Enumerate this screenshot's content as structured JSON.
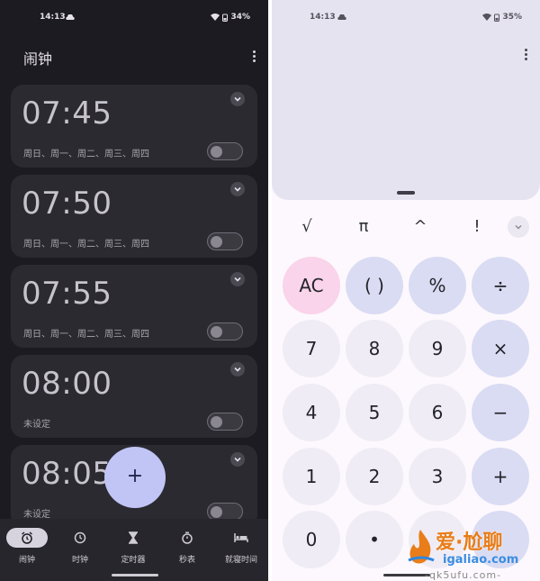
{
  "clock": {
    "status": {
      "time": "14:13",
      "battery": "34%"
    },
    "title": "闹钟",
    "alarms": [
      {
        "time": "07:45",
        "days": "周日、周一、周二、周三、周四",
        "enabled": false
      },
      {
        "time": "07:50",
        "days": "周日、周一、周二、周三、周四",
        "enabled": false
      },
      {
        "time": "07:55",
        "days": "周日、周一、周二、周三、周四",
        "enabled": false
      },
      {
        "time": "08:00",
        "days": "未设定",
        "enabled": false
      },
      {
        "time": "08:05",
        "days": "未设定",
        "enabled": false
      }
    ],
    "fab_label": "+",
    "nav": [
      {
        "label": "闹钟",
        "icon": "alarm-icon",
        "active": true
      },
      {
        "label": "时钟",
        "icon": "clock-icon",
        "active": false
      },
      {
        "label": "定时器",
        "icon": "hourglass-icon",
        "active": false
      },
      {
        "label": "秒表",
        "icon": "stopwatch-icon",
        "active": false
      },
      {
        "label": "就寝时间",
        "icon": "bed-icon",
        "active": false
      }
    ]
  },
  "calc": {
    "status": {
      "time": "14:13",
      "battery": "35%"
    },
    "sci_keys": [
      "√",
      "π",
      "^",
      "!"
    ],
    "keys": [
      [
        "AC",
        "( )",
        "%",
        "÷"
      ],
      [
        "7",
        "8",
        "9",
        "×"
      ],
      [
        "4",
        "5",
        "6",
        "−"
      ],
      [
        "1",
        "2",
        "3",
        "+"
      ],
      [
        "0",
        "•",
        "",
        ""
      ]
    ]
  },
  "watermark": {
    "text": "爱·尬聊",
    "sub": "igaliao.com",
    "sub2": "-qk5ufu.com-"
  },
  "colors": {
    "clock_bg": "#1c1b21",
    "card_bg": "#2b2a31",
    "fab": "#c0c5f5",
    "calc_display": "#e6e3f1",
    "calc_num_key": "#efecf5",
    "calc_op_key": "#d9dcf3",
    "calc_ac_key": "#f9d4ea"
  }
}
